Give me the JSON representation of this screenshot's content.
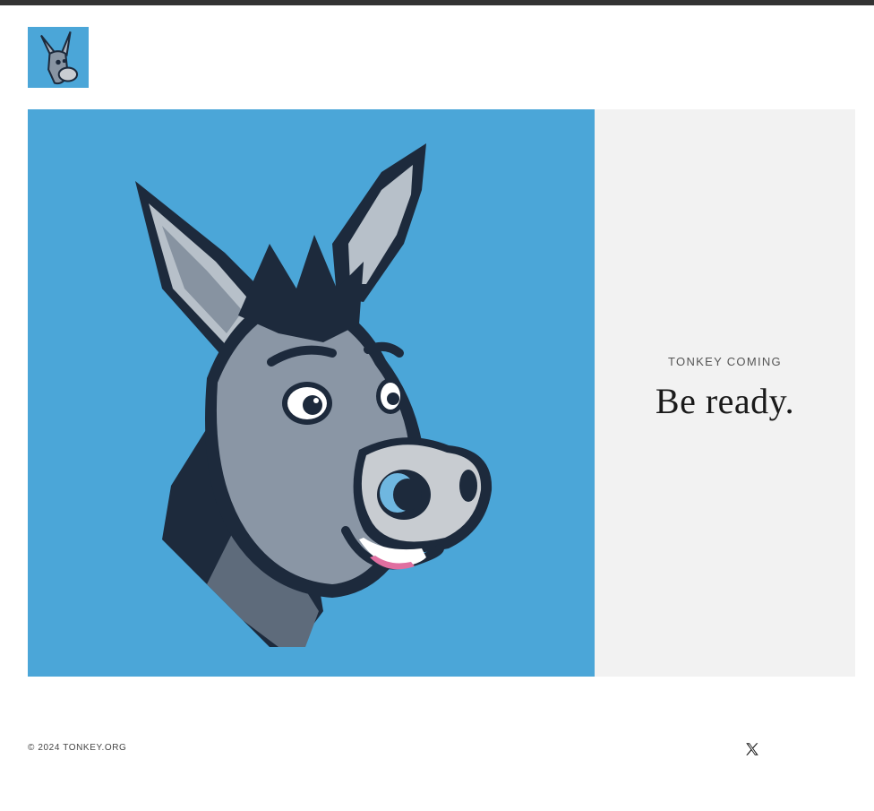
{
  "header": {
    "logo_alt": "Tonkey logo",
    "logo_icon": "donkey-mascot-icon"
  },
  "hero": {
    "image_alt": "Tonkey donkey mascot",
    "image_icon": "donkey-mascot-illustration",
    "eyebrow": "TONKEY COMING",
    "headline": "Be ready."
  },
  "footer": {
    "copyright": "© 2024 TONKEY.ORG",
    "social_icon": "x-twitter-icon"
  },
  "colors": {
    "top_bar": "#333333",
    "brand_blue": "#4ba6d8",
    "panel_bg": "#f2f2f2",
    "text_dark": "#1a1a1a"
  }
}
